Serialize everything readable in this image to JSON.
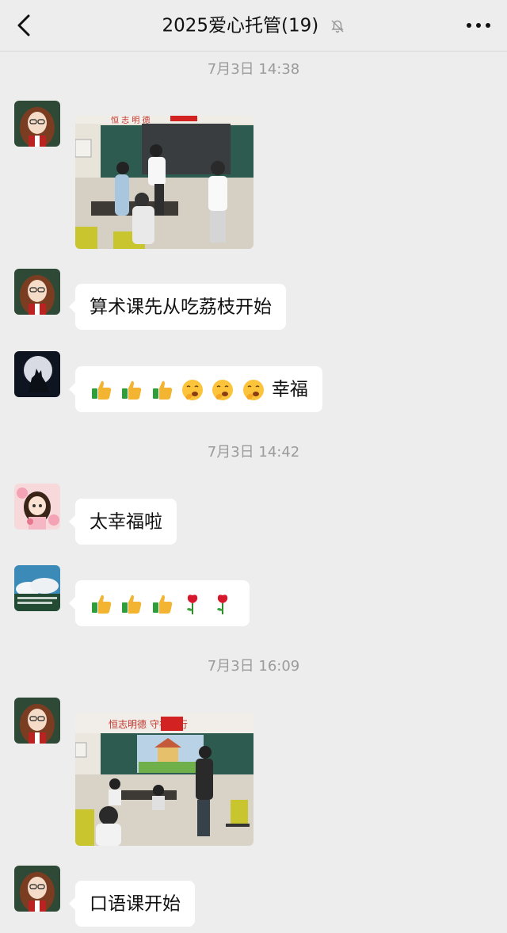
{
  "header": {
    "title": "2025爱心托管(19)",
    "back_icon": "chevron-left-icon",
    "mute_icon": "bell-off-icon",
    "more_icon": "more-dots-icon"
  },
  "messages": [
    {
      "type": "timestamp",
      "text": "7月3日 14:38"
    },
    {
      "type": "image",
      "sender": "teacher",
      "image_desc": "classroom-photo"
    },
    {
      "type": "text",
      "sender": "teacher",
      "text": "算术课先从吃荔枝开始"
    },
    {
      "type": "emoji_text",
      "sender": "wolf",
      "emojis": [
        "thumbs-up",
        "thumbs-up",
        "thumbs-up",
        "yawn-face",
        "yawn-face",
        "yawn-face"
      ],
      "text": "幸福"
    },
    {
      "type": "timestamp",
      "text": "7月3日 14:42"
    },
    {
      "type": "text",
      "sender": "girl",
      "text": "太幸福啦"
    },
    {
      "type": "emoji_text",
      "sender": "sky",
      "emojis": [
        "thumbs-up",
        "thumbs-up",
        "thumbs-up",
        "rose",
        "rose"
      ],
      "text": ""
    },
    {
      "type": "timestamp",
      "text": "7月3日 16:09"
    },
    {
      "type": "image",
      "sender": "teacher",
      "image_desc": "classroom-photo-2",
      "banner_text": "恒志明德 守礼笃行"
    },
    {
      "type": "text",
      "sender": "teacher",
      "text": "口语课开始"
    }
  ],
  "colors": {
    "background": "#ededed",
    "bubble": "#ffffff",
    "timestamp": "#9b9b9b"
  }
}
